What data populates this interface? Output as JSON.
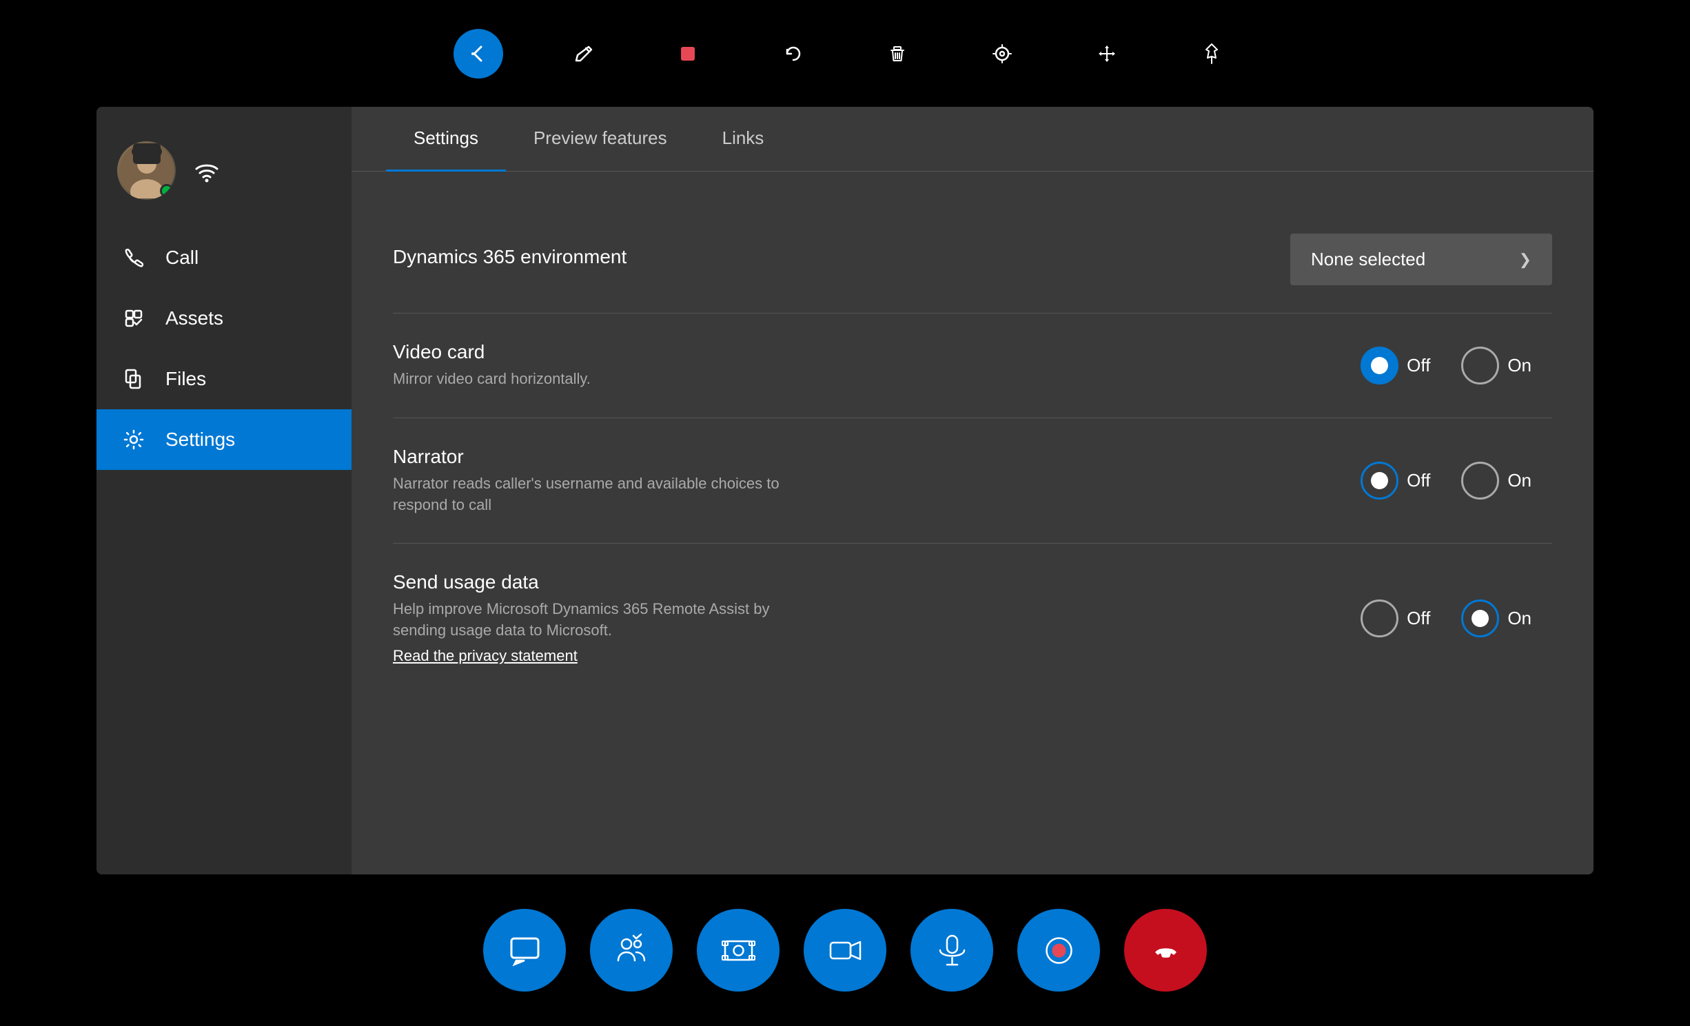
{
  "toolbar": {
    "back_icon": "←",
    "pen_icon": "✏",
    "record_icon": "■",
    "undo_icon": "↩",
    "delete_icon": "🗑",
    "target_icon": "◎",
    "move_icon": "✛",
    "pin_icon": "📌"
  },
  "sidebar": {
    "items": [
      {
        "id": "call",
        "label": "Call"
      },
      {
        "id": "assets",
        "label": "Assets"
      },
      {
        "id": "files",
        "label": "Files"
      },
      {
        "id": "settings",
        "label": "Settings",
        "active": true
      }
    ]
  },
  "tabs": [
    {
      "id": "settings",
      "label": "Settings",
      "active": true
    },
    {
      "id": "preview",
      "label": "Preview features"
    },
    {
      "id": "links",
      "label": "Links"
    }
  ],
  "settings": {
    "dynamics_label": "Dynamics 365 environment",
    "dynamics_value": "None selected",
    "video_card_title": "Video card",
    "video_card_desc": "Mirror video card horizontally.",
    "narrator_title": "Narrator",
    "narrator_desc": "Narrator reads caller's username and available choices to respond to call",
    "send_usage_title": "Send usage data",
    "send_usage_desc": "Help improve Microsoft Dynamics 365 Remote Assist by sending usage data to Microsoft.",
    "privacy_link": "Read the privacy statement"
  },
  "bottom_toolbar": {
    "chat_icon": "💬",
    "participants_icon": "👥",
    "screenshot_icon": "📷",
    "video_icon": "📹",
    "mic_icon": "🎤",
    "record_icon": "⏺",
    "end_call_icon": "📞"
  }
}
